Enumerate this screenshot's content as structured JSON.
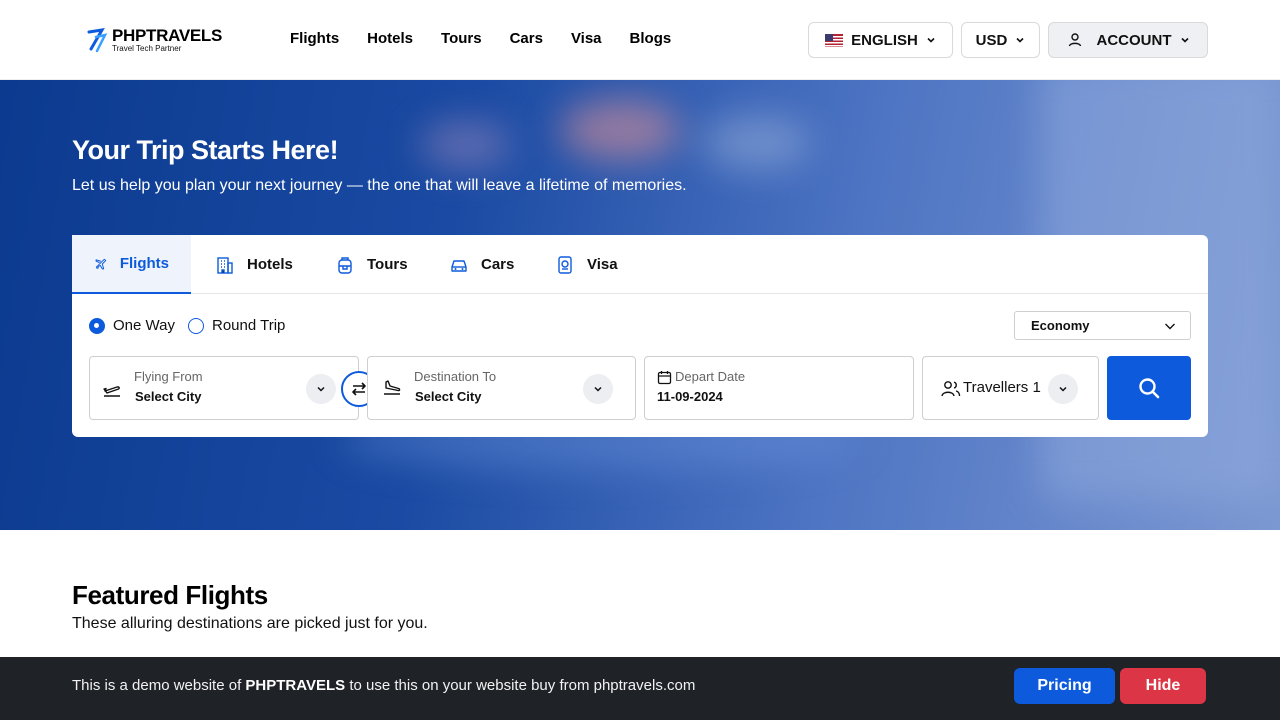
{
  "header": {
    "logo_name": "PHPTRAVELS",
    "logo_tagline": "Travel Tech Partner",
    "nav": [
      "Flights",
      "Hotels",
      "Tours",
      "Cars",
      "Visa",
      "Blogs"
    ],
    "language": "ENGLISH",
    "currency": "USD",
    "account": "ACCOUNT"
  },
  "hero": {
    "title": "Your Trip Starts Here!",
    "subtitle": "Let us help you plan your next journey — the one that will leave a lifetime of memories."
  },
  "search": {
    "tabs": [
      "Flights",
      "Hotels",
      "Tours",
      "Cars",
      "Visa"
    ],
    "active_tab": "Flights",
    "trip_types": [
      "One Way",
      "Round Trip"
    ],
    "selected_trip": "One Way",
    "cabin_class": "Economy",
    "from_label": "Flying From",
    "from_value": "Select City",
    "to_label": "Destination To",
    "to_value": "Select City",
    "date_label": "Depart Date",
    "date_value": "11-09-2024",
    "travellers": "Travellers 1"
  },
  "featured": {
    "title": "Featured Flights",
    "subtitle": "These alluring destinations are picked just for you."
  },
  "demo_bar": {
    "text_before": "This is a demo website of",
    "brand": "PHPTRAVELS",
    "text_after": "to use this on your website buy from phptravels.com",
    "pricing_label": "Pricing",
    "hide_label": "Hide"
  },
  "colors": {
    "primary": "#0d5bdc",
    "danger": "#dc3545",
    "hero_dark": "#0b3a8f",
    "demo_bg": "#1f2227"
  }
}
